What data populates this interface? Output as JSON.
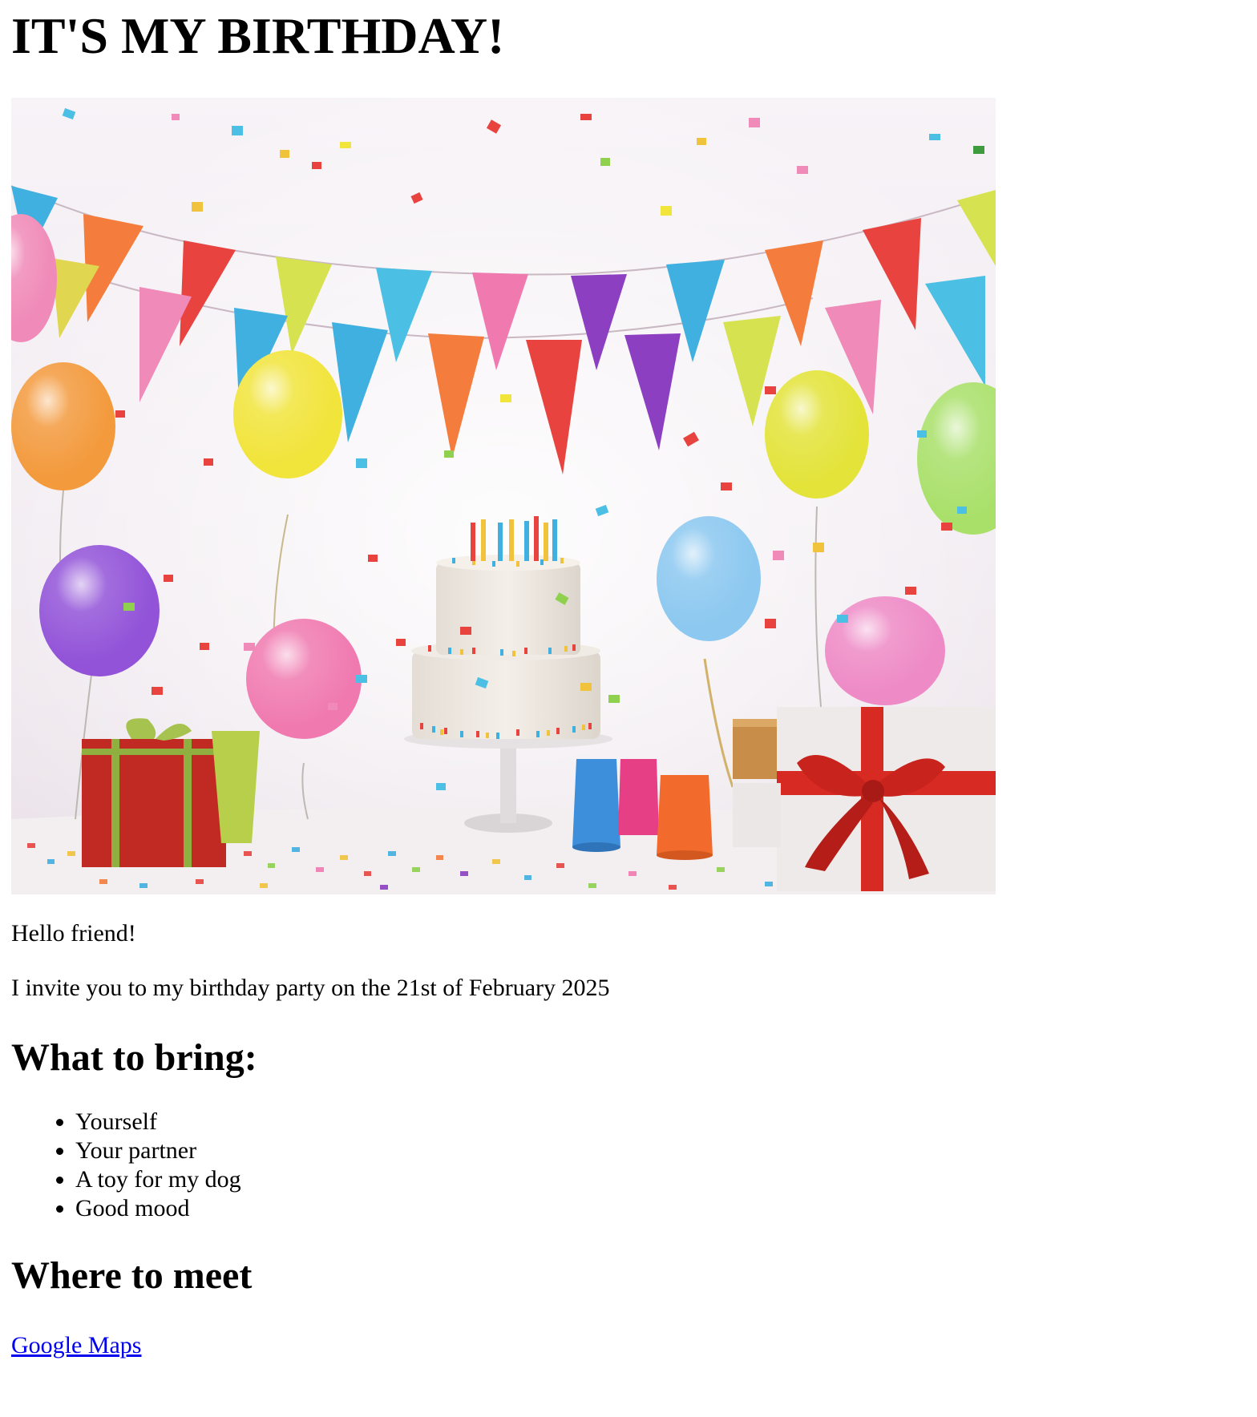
{
  "page": {
    "title": "IT'S MY BIRTHDAY!",
    "greeting": "Hello friend!",
    "invite": "I invite you to my birthday party on the 21st of February 2025",
    "bring_heading": "What to bring:",
    "bring_items": [
      "Yourself",
      "Your partner",
      "A toy for my dog",
      "Good mood"
    ],
    "meet_heading": "Where to meet",
    "map_link": "Google Maps"
  },
  "colors": {
    "link": "#0000ee"
  },
  "image": {
    "subject": "birthday party scene"
  }
}
